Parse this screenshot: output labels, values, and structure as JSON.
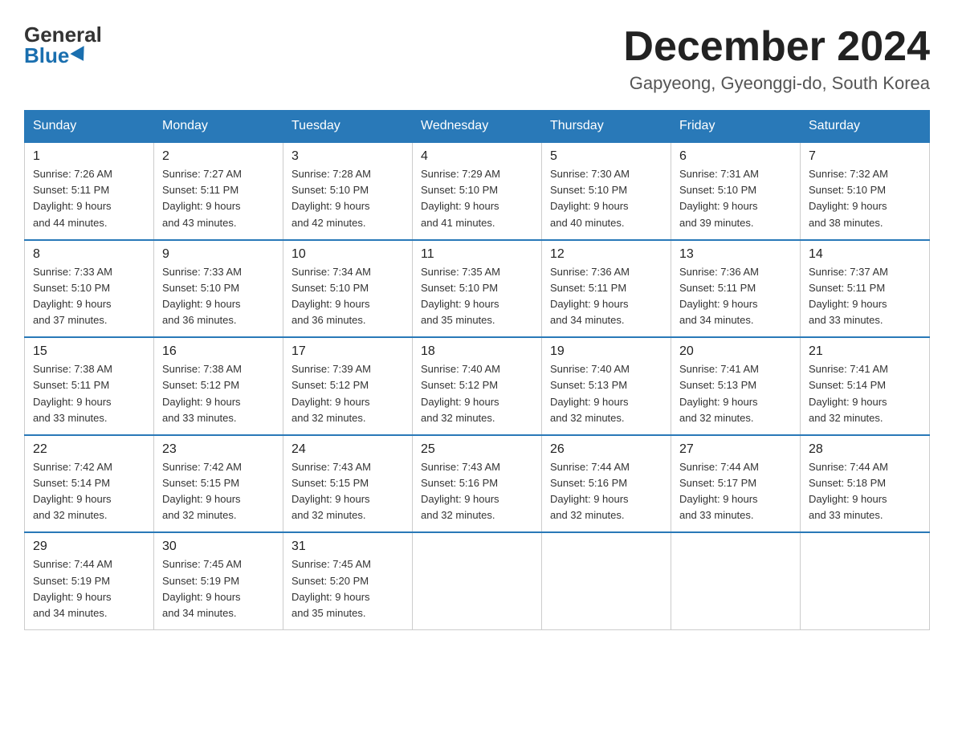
{
  "logo": {
    "general": "General",
    "blue": "Blue"
  },
  "header": {
    "month_year": "December 2024",
    "location": "Gapyeong, Gyeonggi-do, South Korea"
  },
  "days_of_week": [
    "Sunday",
    "Monday",
    "Tuesday",
    "Wednesday",
    "Thursday",
    "Friday",
    "Saturday"
  ],
  "weeks": [
    [
      {
        "day": "1",
        "sunrise": "7:26 AM",
        "sunset": "5:11 PM",
        "daylight": "9 hours and 44 minutes."
      },
      {
        "day": "2",
        "sunrise": "7:27 AM",
        "sunset": "5:11 PM",
        "daylight": "9 hours and 43 minutes."
      },
      {
        "day": "3",
        "sunrise": "7:28 AM",
        "sunset": "5:10 PM",
        "daylight": "9 hours and 42 minutes."
      },
      {
        "day": "4",
        "sunrise": "7:29 AM",
        "sunset": "5:10 PM",
        "daylight": "9 hours and 41 minutes."
      },
      {
        "day": "5",
        "sunrise": "7:30 AM",
        "sunset": "5:10 PM",
        "daylight": "9 hours and 40 minutes."
      },
      {
        "day": "6",
        "sunrise": "7:31 AM",
        "sunset": "5:10 PM",
        "daylight": "9 hours and 39 minutes."
      },
      {
        "day": "7",
        "sunrise": "7:32 AM",
        "sunset": "5:10 PM",
        "daylight": "9 hours and 38 minutes."
      }
    ],
    [
      {
        "day": "8",
        "sunrise": "7:33 AM",
        "sunset": "5:10 PM",
        "daylight": "9 hours and 37 minutes."
      },
      {
        "day": "9",
        "sunrise": "7:33 AM",
        "sunset": "5:10 PM",
        "daylight": "9 hours and 36 minutes."
      },
      {
        "day": "10",
        "sunrise": "7:34 AM",
        "sunset": "5:10 PM",
        "daylight": "9 hours and 36 minutes."
      },
      {
        "day": "11",
        "sunrise": "7:35 AM",
        "sunset": "5:10 PM",
        "daylight": "9 hours and 35 minutes."
      },
      {
        "day": "12",
        "sunrise": "7:36 AM",
        "sunset": "5:11 PM",
        "daylight": "9 hours and 34 minutes."
      },
      {
        "day": "13",
        "sunrise": "7:36 AM",
        "sunset": "5:11 PM",
        "daylight": "9 hours and 34 minutes."
      },
      {
        "day": "14",
        "sunrise": "7:37 AM",
        "sunset": "5:11 PM",
        "daylight": "9 hours and 33 minutes."
      }
    ],
    [
      {
        "day": "15",
        "sunrise": "7:38 AM",
        "sunset": "5:11 PM",
        "daylight": "9 hours and 33 minutes."
      },
      {
        "day": "16",
        "sunrise": "7:38 AM",
        "sunset": "5:12 PM",
        "daylight": "9 hours and 33 minutes."
      },
      {
        "day": "17",
        "sunrise": "7:39 AM",
        "sunset": "5:12 PM",
        "daylight": "9 hours and 32 minutes."
      },
      {
        "day": "18",
        "sunrise": "7:40 AM",
        "sunset": "5:12 PM",
        "daylight": "9 hours and 32 minutes."
      },
      {
        "day": "19",
        "sunrise": "7:40 AM",
        "sunset": "5:13 PM",
        "daylight": "9 hours and 32 minutes."
      },
      {
        "day": "20",
        "sunrise": "7:41 AM",
        "sunset": "5:13 PM",
        "daylight": "9 hours and 32 minutes."
      },
      {
        "day": "21",
        "sunrise": "7:41 AM",
        "sunset": "5:14 PM",
        "daylight": "9 hours and 32 minutes."
      }
    ],
    [
      {
        "day": "22",
        "sunrise": "7:42 AM",
        "sunset": "5:14 PM",
        "daylight": "9 hours and 32 minutes."
      },
      {
        "day": "23",
        "sunrise": "7:42 AM",
        "sunset": "5:15 PM",
        "daylight": "9 hours and 32 minutes."
      },
      {
        "day": "24",
        "sunrise": "7:43 AM",
        "sunset": "5:15 PM",
        "daylight": "9 hours and 32 minutes."
      },
      {
        "day": "25",
        "sunrise": "7:43 AM",
        "sunset": "5:16 PM",
        "daylight": "9 hours and 32 minutes."
      },
      {
        "day": "26",
        "sunrise": "7:44 AM",
        "sunset": "5:16 PM",
        "daylight": "9 hours and 32 minutes."
      },
      {
        "day": "27",
        "sunrise": "7:44 AM",
        "sunset": "5:17 PM",
        "daylight": "9 hours and 33 minutes."
      },
      {
        "day": "28",
        "sunrise": "7:44 AM",
        "sunset": "5:18 PM",
        "daylight": "9 hours and 33 minutes."
      }
    ],
    [
      {
        "day": "29",
        "sunrise": "7:44 AM",
        "sunset": "5:19 PM",
        "daylight": "9 hours and 34 minutes."
      },
      {
        "day": "30",
        "sunrise": "7:45 AM",
        "sunset": "5:19 PM",
        "daylight": "9 hours and 34 minutes."
      },
      {
        "day": "31",
        "sunrise": "7:45 AM",
        "sunset": "5:20 PM",
        "daylight": "9 hours and 35 minutes."
      },
      null,
      null,
      null,
      null
    ]
  ],
  "labels": {
    "sunrise": "Sunrise:",
    "sunset": "Sunset:",
    "daylight": "Daylight:"
  }
}
